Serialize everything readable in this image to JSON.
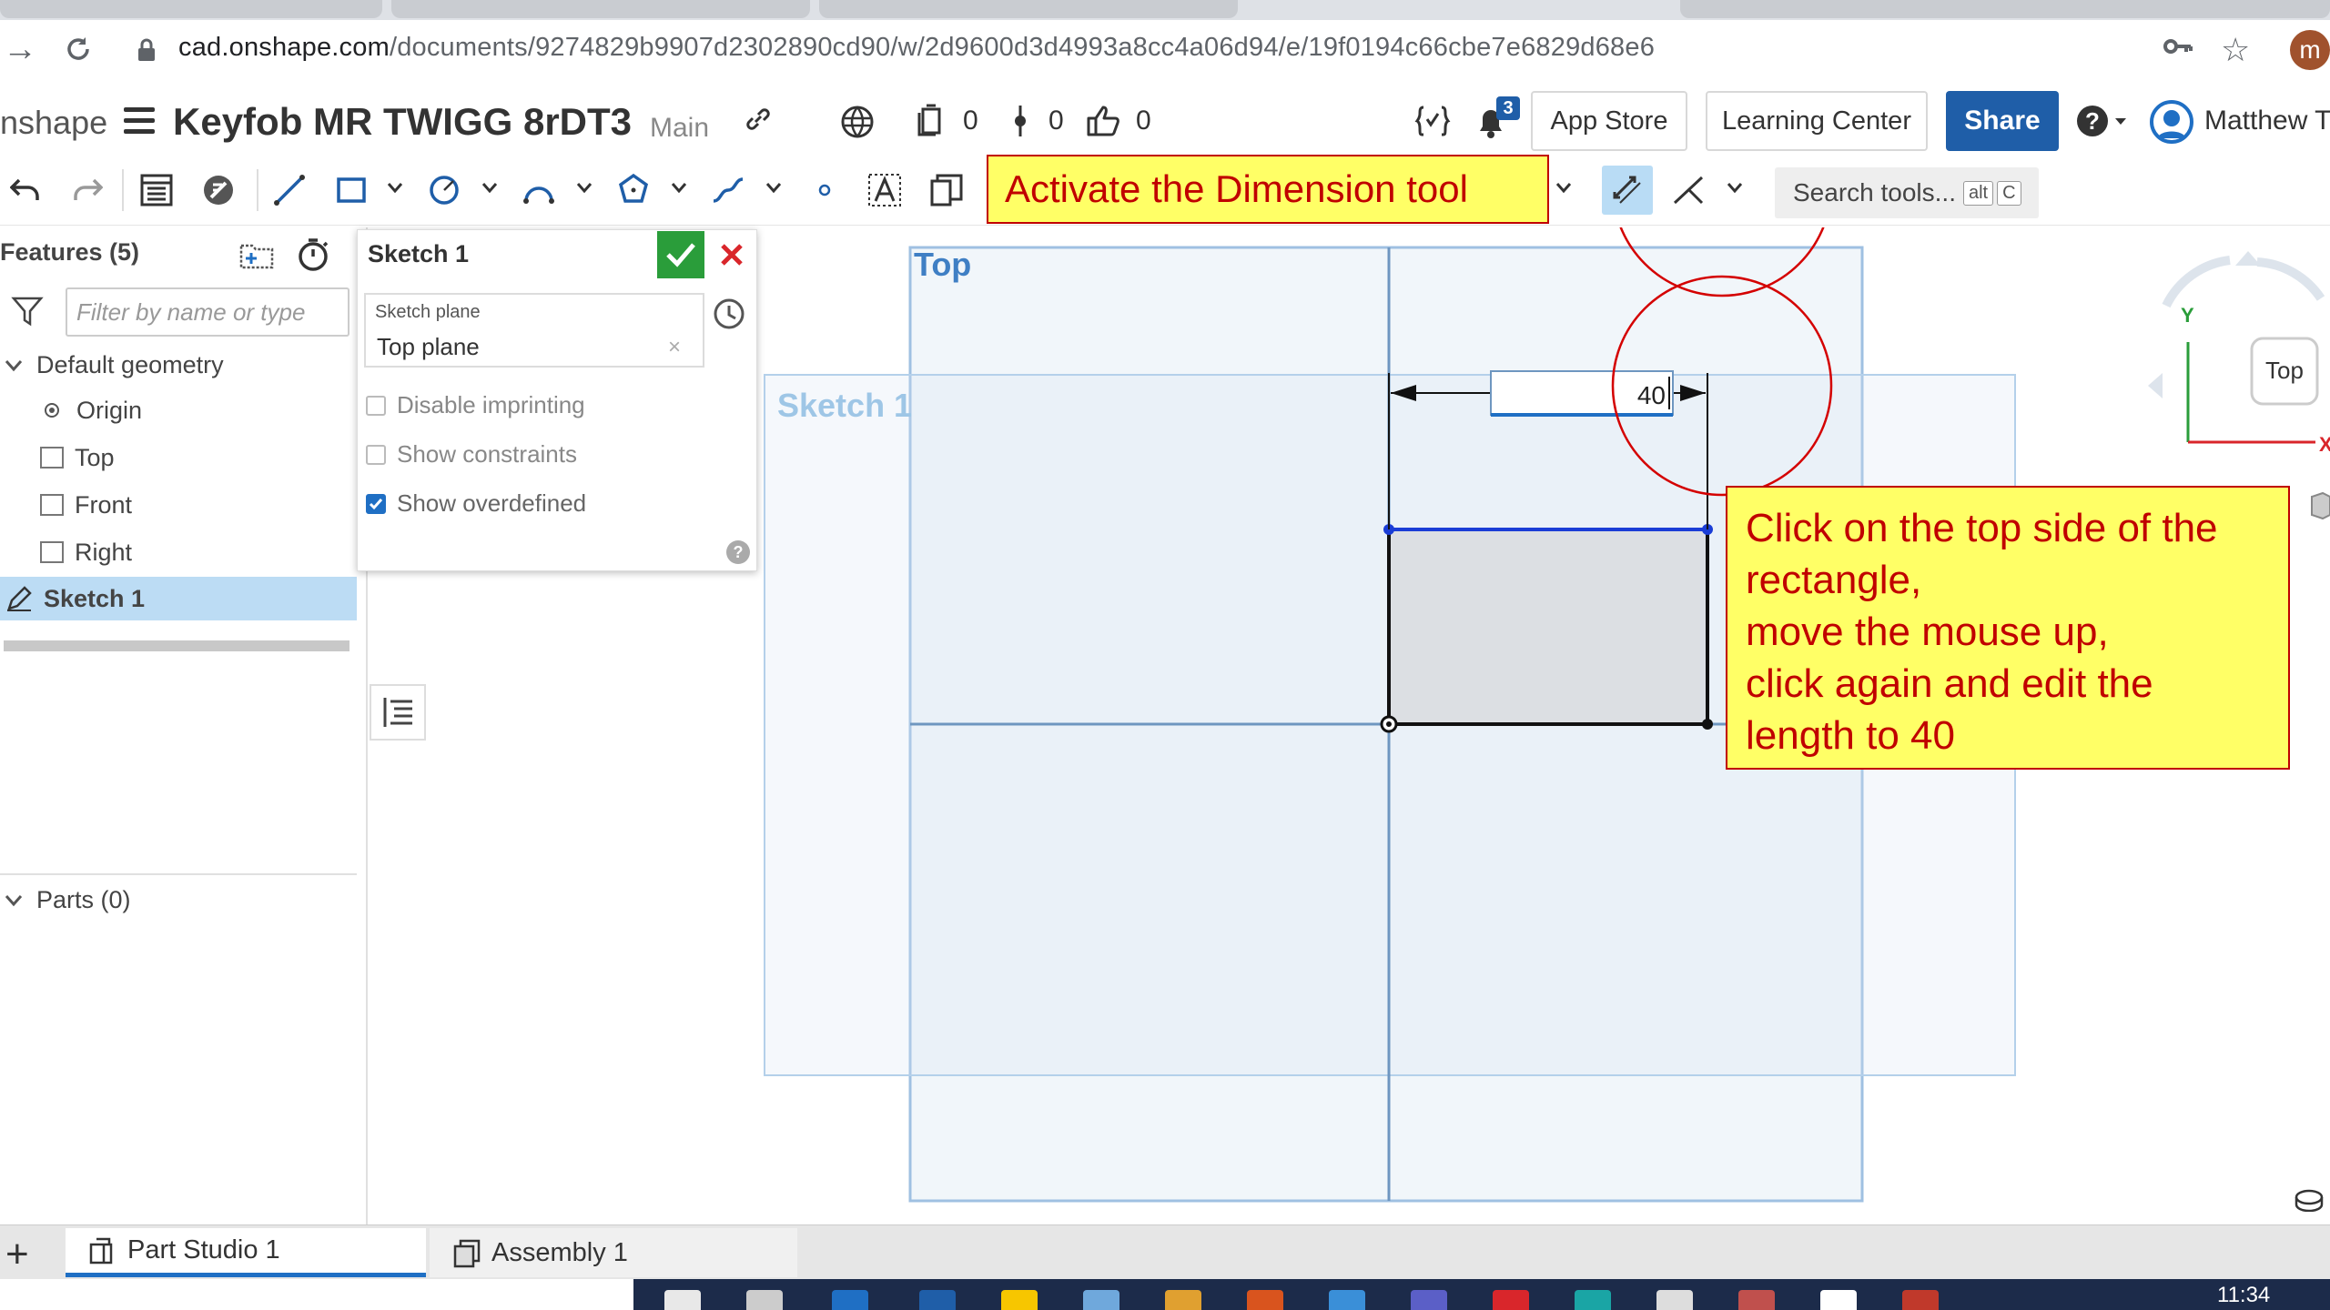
{
  "browser": {
    "url_host": "cad.onshape.com",
    "url_path": "/documents/9274829b9907d2302890cd90/w/2d9600d3d4993a8cc4a06d94/e/19f0194c66cbe7e6829d68e6",
    "profile_initial": "m"
  },
  "header": {
    "brand": "nshape",
    "doc_title": "Keyfob MR TWIGG 8rDT3",
    "branch": "Main",
    "versions_count": "0",
    "branches_count": "0",
    "likes_count": "0",
    "notifications_badge": "3",
    "app_store": "App Store",
    "learning_center": "Learning Center",
    "share": "Share",
    "user_name": "Matthew Tv"
  },
  "toolbar": {
    "search_placeholder": "Search tools...",
    "kbd_alt": "alt",
    "kbd_c": "C"
  },
  "features": {
    "title": "Features (5)",
    "filter_placeholder": "Filter by name or type",
    "default_geometry": "Default geometry",
    "items": [
      "Origin",
      "Top",
      "Front",
      "Right"
    ],
    "sketch_item": "Sketch 1",
    "parts": "Parts (0)"
  },
  "sketch_dialog": {
    "title": "Sketch 1",
    "plane_label": "Sketch plane",
    "plane_value": "Top plane",
    "clear": "×",
    "opt_disable_imprinting": "Disable imprinting",
    "opt_show_constraints": "Show constraints",
    "opt_show_overdefined": "Show overdefined",
    "help": "?"
  },
  "canvas": {
    "plane_label_top": "Top",
    "sketch_label": "Sketch 1",
    "dimension_value": "40",
    "view_cube_label": "Top",
    "axis_y": "Y",
    "axis_x": "X"
  },
  "callouts": {
    "activate": "Activate the Dimension tool",
    "instructions": [
      "Click on the top side of the",
      "rectangle,",
      "move the mouse up,",
      "click again and edit the",
      "length to 40"
    ]
  },
  "bottom_tabs": {
    "plus": "+",
    "part_studio": "Part Studio 1",
    "assembly": "Assembly 1"
  },
  "taskbar": {
    "clock": "11:34"
  },
  "colors": {
    "accent": "#1f5ea8",
    "callout_fill": "#ffff66",
    "callout_text": "#c00000",
    "selected_row": "#bcdcf4",
    "ok_green": "#2a9d3a"
  }
}
